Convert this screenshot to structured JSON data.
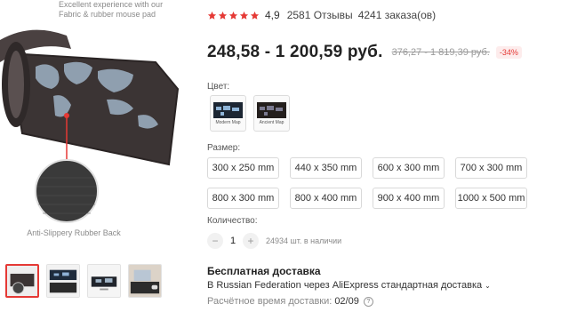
{
  "gallery": {
    "hero_caption": "Excellent experience with our Fabric & rubber mouse pad",
    "backing_caption": "Anti-Slippery Rubber Back",
    "thumbnails": [
      {
        "name": "thumb-1"
      },
      {
        "name": "thumb-2"
      },
      {
        "name": "thumb-3"
      },
      {
        "name": "thumb-4"
      }
    ]
  },
  "product": {
    "rating": {
      "stars": 5,
      "value": "4,9",
      "reviews": "2581 Отзывы",
      "orders": "4241 заказа(ов)",
      "star_color": "#e53935"
    },
    "price": {
      "range": "248,58 - 1 200,59 руб.",
      "old_range": "376,27 - 1 819,39 руб.",
      "discount": "-34%"
    },
    "color_label": "Цвет:",
    "colors": [
      {
        "caption": "Modern Map"
      },
      {
        "caption": "Ancient Map"
      }
    ],
    "size_label": "Размер:",
    "sizes": [
      "300 x 250 mm",
      "440 x 350 mm",
      "600 x 300 mm",
      "700 x 300 mm",
      "800 x 300 mm",
      "800 x 400 mm",
      "900 x 400 mm",
      "1000 x 500 mm"
    ],
    "quantity_label": "Количество:",
    "quantity": {
      "minus": "−",
      "value": "1",
      "plus": "+",
      "stock": "24934 шт. в наличии"
    },
    "shipping": {
      "title": "Бесплатная доставка",
      "line": "В Russian Federation через AliExpress стандартная доставка",
      "delivery_label": "Расчётное время доставки:",
      "delivery_date": "02/09",
      "help": "?"
    }
  }
}
